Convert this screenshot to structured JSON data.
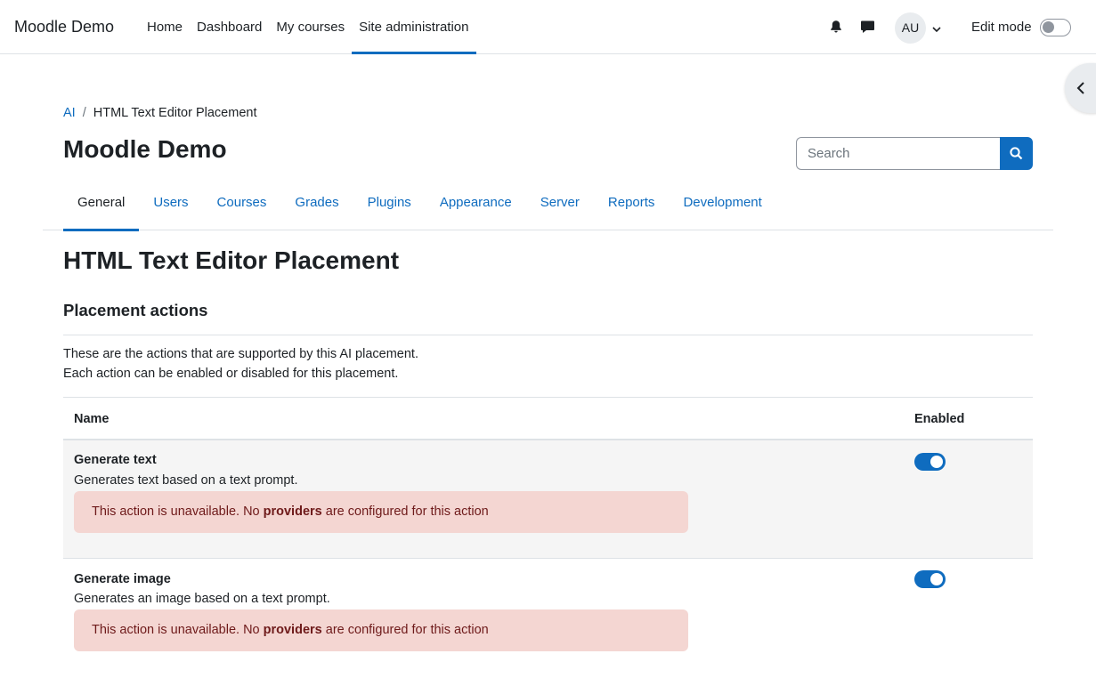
{
  "navbar": {
    "brand": "Moodle Demo",
    "items": [
      {
        "label": "Home"
      },
      {
        "label": "Dashboard"
      },
      {
        "label": "My courses"
      },
      {
        "label": "Site administration"
      }
    ],
    "user_initials": "AU",
    "edit_mode_label": "Edit mode",
    "edit_mode_on": false
  },
  "breadcrumb": {
    "items": [
      {
        "label": "AI"
      },
      {
        "label": "HTML Text Editor Placement"
      }
    ],
    "separator": "/"
  },
  "page_header": "Moodle Demo",
  "search": {
    "placeholder": "Search"
  },
  "tabs": [
    {
      "label": "General",
      "active": true
    },
    {
      "label": "Users"
    },
    {
      "label": "Courses"
    },
    {
      "label": "Grades"
    },
    {
      "label": "Plugins"
    },
    {
      "label": "Appearance"
    },
    {
      "label": "Server"
    },
    {
      "label": "Reports"
    },
    {
      "label": "Development"
    }
  ],
  "main": {
    "heading": "HTML Text Editor Placement",
    "section_heading": "Placement actions",
    "description_line1": "These are the actions that are supported by this AI placement.",
    "description_line2": "Each action can be enabled or disabled for this placement."
  },
  "table": {
    "headers": {
      "name": "Name",
      "enabled": "Enabled"
    },
    "rows": [
      {
        "name": "Generate text",
        "description": "Generates text based on a text prompt.",
        "alert_before": "This action is unavailable. No ",
        "alert_bold": "providers",
        "alert_after": " are configured for this action",
        "enabled": true
      },
      {
        "name": "Generate image",
        "description": "Generates an image based on a text prompt.",
        "alert_before": "This action is unavailable. No ",
        "alert_bold": "providers",
        "alert_after": " are configured for this action",
        "enabled": true
      }
    ]
  },
  "colors": {
    "primary": "#0f6cbf",
    "alert_bg": "#f4d6d2",
    "alert_text": "#6e1a1a",
    "row_highlight": "#f5f5f5"
  },
  "icons": [
    "bell-icon",
    "chat-icon",
    "chevron-down-icon",
    "chevron-left-icon",
    "search-icon"
  ]
}
